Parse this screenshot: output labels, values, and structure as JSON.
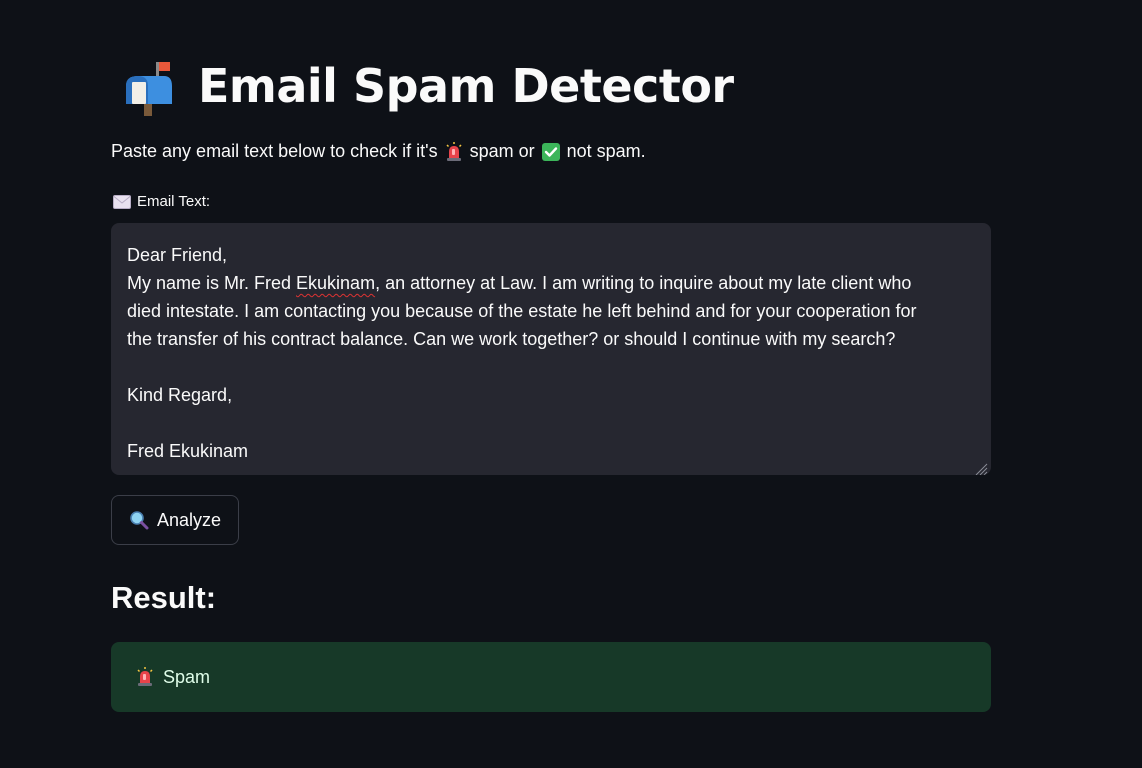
{
  "header": {
    "title": "Email Spam Detector",
    "icon": "mailbox-with-flag-icon"
  },
  "intro": {
    "text_before": "Paste any email text below to check if it's",
    "spam_icon": "siren-icon",
    "spam_word": "spam or",
    "ok_icon": "check-mark-icon",
    "ok_word": "not spam."
  },
  "input": {
    "label": "Email Text:",
    "label_icon": "envelope-icon",
    "lines": [
      "Dear Friend,",
      "My name is Mr. Fred ",
      "died intestate. I am contacting you because of the estate he left behind and for your cooperation for",
      "the transfer of his contract balance. Can we work together? or should I continue with my search?",
      "",
      "Kind Regard,",
      "",
      "Fred Ekukinam"
    ],
    "misspelled_word": "Ekukinam",
    "line2_rest": ", an attorney at Law. I am writing to inquire about my late client who"
  },
  "actions": {
    "analyze_label": "Analyze",
    "analyze_icon": "magnifying-glass-icon"
  },
  "result": {
    "heading": "Result:",
    "label": "Spam",
    "icon": "siren-icon",
    "colors": {
      "box_background": "#173928",
      "text": "#dffde9"
    }
  }
}
